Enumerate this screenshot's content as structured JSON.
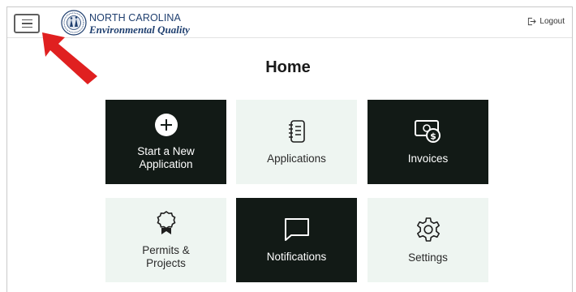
{
  "header": {
    "menu_icon": "hamburger-menu-icon",
    "logo": {
      "line1": "NORTH CAROLINA",
      "line2": "Environmental Quality",
      "seal_icon": "state-seal-icon"
    },
    "logout_label": "Logout",
    "logout_icon": "logout-icon"
  },
  "page": {
    "title": "Home"
  },
  "tiles": [
    {
      "label": "Start a New\nApplication",
      "icon": "plus-circle-icon",
      "style": "dark"
    },
    {
      "label": "Applications",
      "icon": "notebook-list-icon",
      "style": "light"
    },
    {
      "label": "Invoices",
      "icon": "money-invoice-icon",
      "style": "dark"
    },
    {
      "label": "Permits &\nProjects",
      "icon": "award-ribbon-icon",
      "style": "light"
    },
    {
      "label": "Notifications",
      "icon": "chat-bubble-icon",
      "style": "dark"
    },
    {
      "label": "Settings",
      "icon": "gear-icon",
      "style": "light"
    }
  ],
  "colors": {
    "dark_tile": "#121a16",
    "light_tile": "#eef5f1",
    "logo_blue": "#1f3f6f",
    "arrow_red": "#e02020"
  },
  "annotation": {
    "arrow_icon": "red-pointer-arrow-icon"
  }
}
